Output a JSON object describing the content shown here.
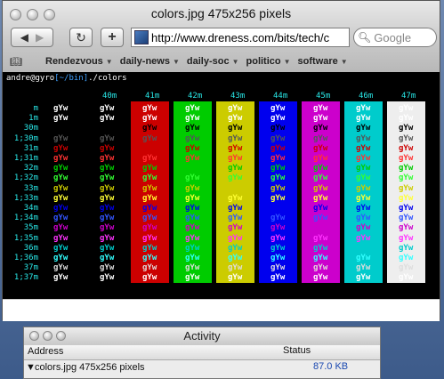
{
  "window": {
    "title": "colors.jpg 475x256 pixels",
    "url": "http://www.dreness.com/bits/tech/c",
    "search_placeholder": "Google"
  },
  "bookmarks": [
    {
      "label": "Rendezvous",
      "menu": true
    },
    {
      "label": "daily-news",
      "menu": true
    },
    {
      "label": "daily-soc",
      "menu": true
    },
    {
      "label": "politico",
      "menu": true
    },
    {
      "label": "software",
      "menu": true
    }
  ],
  "terminal": {
    "prompt_user": "andre",
    "prompt_at": "@",
    "prompt_host": "gyro",
    "prompt_path": "[~/bin]",
    "prompt_cmd": "./colors",
    "sample_text": "gYw",
    "bg_codes": [
      "40m",
      "41m",
      "42m",
      "43m",
      "44m",
      "45m",
      "46m",
      "47m"
    ],
    "bg_colors": [
      "#000000",
      "#cc0000",
      "#00cc00",
      "#cccc00",
      "#0000ee",
      "#cc00cc",
      "#00cccc",
      "#eeeeee"
    ],
    "rows": [
      {
        "code": "m",
        "fg": "#ffffff"
      },
      {
        "code": "1m",
        "fg": "#ffffff"
      },
      {
        "code": "30m",
        "fg": "#000000"
      },
      {
        "code": "1;30m",
        "fg": "#555555"
      },
      {
        "code": "31m",
        "fg": "#cc0000"
      },
      {
        "code": "1;31m",
        "fg": "#ff3333"
      },
      {
        "code": "32m",
        "fg": "#00cc00"
      },
      {
        "code": "1;32m",
        "fg": "#33ff33"
      },
      {
        "code": "33m",
        "fg": "#cccc00"
      },
      {
        "code": "1;33m",
        "fg": "#ffff33"
      },
      {
        "code": "34m",
        "fg": "#0000ee"
      },
      {
        "code": "1;34m",
        "fg": "#3355ff"
      },
      {
        "code": "35m",
        "fg": "#cc00cc"
      },
      {
        "code": "1;35m",
        "fg": "#ff33ff"
      },
      {
        "code": "36m",
        "fg": "#00cccc"
      },
      {
        "code": "1;36m",
        "fg": "#33ffff"
      },
      {
        "code": "37m",
        "fg": "#dddddd"
      },
      {
        "code": "1;37m",
        "fg": "#ffffff"
      }
    ]
  },
  "activity": {
    "title": "Activity",
    "col_address": "Address",
    "col_status": "Status",
    "row_address": "colors.jpg 475x256 pixels",
    "row_status": "87.0 KB"
  }
}
